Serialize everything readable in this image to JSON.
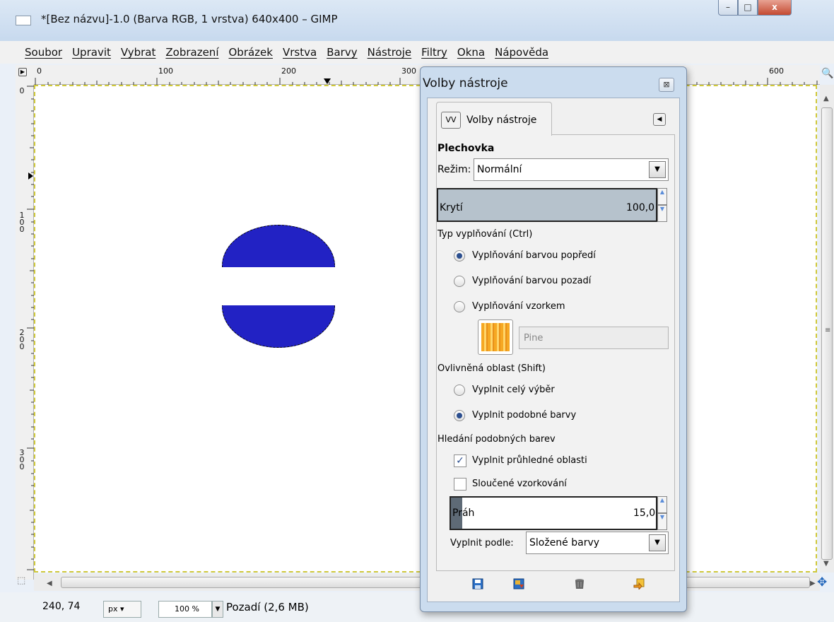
{
  "window": {
    "title": "*[Bez názvu]-1.0 (Barva RGB, 1 vrstva) 640x400 – GIMP",
    "min_label": "–",
    "max_label": "□",
    "close_label": "x"
  },
  "menu": [
    "Soubor",
    "Upravit",
    "Vybrat",
    "Zobrazení",
    "Obrázek",
    "Vrstva",
    "Barvy",
    "Nástroje",
    "Filtry",
    "Okna",
    "Nápověda"
  ],
  "ruler": {
    "top_labels": [
      "0",
      "100",
      "200",
      "300",
      "600"
    ],
    "left_labels": [
      "0",
      "1 0 0",
      "2 0 0",
      "3 0 0"
    ]
  },
  "canvas": {
    "fill_color": "#2222c4",
    "selection": "marching-ants"
  },
  "status": {
    "coords": "240, 74",
    "unit": "px",
    "zoom": "100 %",
    "layer": "Pozadí (2,6 MB)"
  },
  "dialog": {
    "title": "Volby nástroje",
    "tab_label": "Volby nástroje",
    "tool_name": "Plechovka",
    "mode_label": "Režim:",
    "mode_value": "Normální",
    "opacity_label": "Krytí",
    "opacity_value": "100,0",
    "fill_type_label": "Typ vyplňování  (Ctrl)",
    "fill_type_options": [
      "Vyplňování barvou popředí",
      "Vyplňování barvou pozadí",
      "Vyplňování vzorkem"
    ],
    "fill_type_selected": 0,
    "pattern_name": "Pine",
    "affected_area_label": "Ovlivněná oblast  (Shift)",
    "affected_area_options": [
      "Vyplnit celý výběr",
      "Vyplnit podobné barvy"
    ],
    "affected_area_selected": 1,
    "similar_label": "Hledání podobných barev",
    "fill_transparent_label": "Vyplnit průhledné oblasti",
    "fill_transparent_checked": true,
    "sample_merged_label": "Sloučené vzorkování",
    "sample_merged_checked": false,
    "threshold_label": "Práh",
    "threshold_value": "15,0",
    "fill_by_label": "Vyplnit podle:",
    "fill_by_value": "Složené barvy",
    "footer_icons": [
      "save-options-icon",
      "restore-options-icon",
      "delete-options-icon",
      "reset-options-icon"
    ]
  }
}
